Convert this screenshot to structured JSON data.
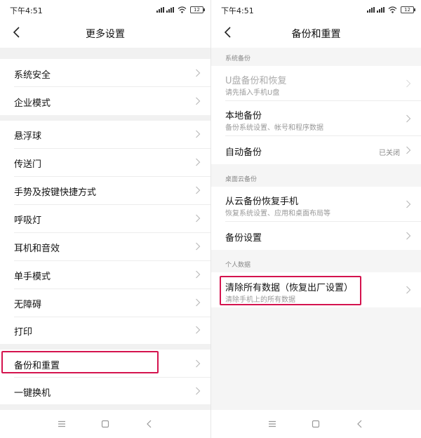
{
  "left": {
    "status_time": "下午4:51",
    "battery": "12",
    "title": "更多设置",
    "items": [
      {
        "label": "系统安全"
      },
      {
        "label": "企业模式"
      },
      {
        "label": "悬浮球"
      },
      {
        "label": "传送门"
      },
      {
        "label": "手势及按键快捷方式"
      },
      {
        "label": "呼吸灯"
      },
      {
        "label": "耳机和音效"
      },
      {
        "label": "单手模式"
      },
      {
        "label": "无障碍"
      },
      {
        "label": "打印"
      },
      {
        "label": "备份和重置"
      },
      {
        "label": "一键换机"
      }
    ]
  },
  "right": {
    "status_time": "下午4:51",
    "battery": "12",
    "title": "备份和重置",
    "sections": [
      {
        "header": "系统备份",
        "items": [
          {
            "label": "U盘备份和恢复",
            "sub": "请先插入手机U盘"
          },
          {
            "label": "本地备份",
            "sub": "备份系统设置、帐号和程序数据"
          },
          {
            "label": "自动备份",
            "value": "已关闭"
          }
        ]
      },
      {
        "header": "桌面云备份",
        "items": [
          {
            "label": "从云备份恢复手机",
            "sub": "恢复系统设置、应用和桌面布局等"
          },
          {
            "label": "备份设置"
          }
        ]
      },
      {
        "header": "个人数据",
        "items": [
          {
            "label": "清除所有数据（恢复出厂设置）",
            "sub": "清除手机上的所有数据"
          }
        ]
      }
    ]
  },
  "colors": {
    "highlight": "#d4134e",
    "page_bg": "#f5f5f5",
    "text": "#111111",
    "subtext": "#999999"
  }
}
